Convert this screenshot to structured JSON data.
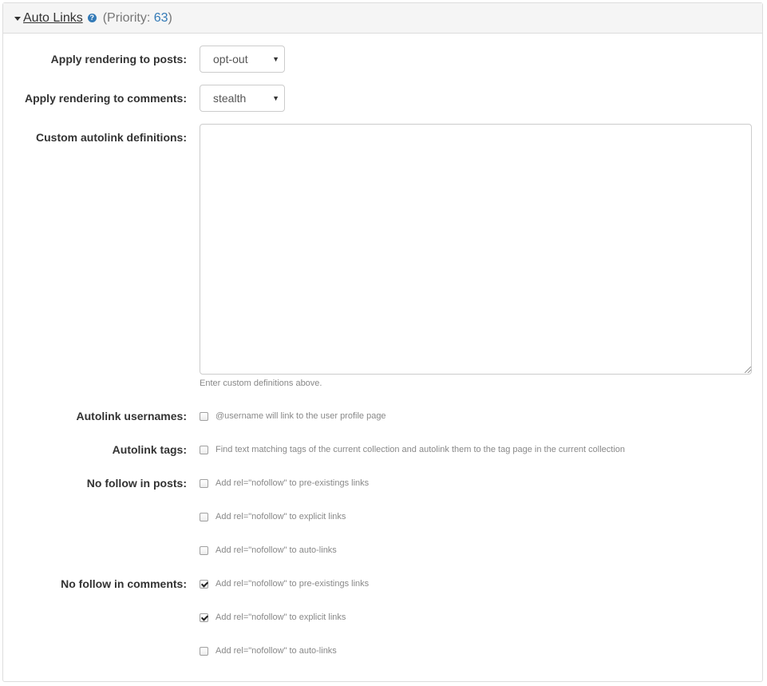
{
  "header": {
    "title": "Auto Links",
    "priority_prefix": "(Priority: ",
    "priority_value": "63",
    "priority_suffix": ")",
    "help_icon": "?"
  },
  "fields": {
    "posts_label": "Apply rendering to posts:",
    "posts_value": "opt-out",
    "comments_label": "Apply rendering to comments:",
    "comments_value": "stealth",
    "custom_label": "Custom autolink definitions:",
    "custom_value": "",
    "custom_help": "Enter custom definitions above.",
    "usernames_label": "Autolink usernames:",
    "usernames_text": "@username will link to the user profile page",
    "usernames_checked": false,
    "tags_label": "Autolink tags:",
    "tags_text": "Find text matching tags of the current collection and autolink them to the tag page in the current collection",
    "tags_checked": false,
    "nofollow_posts_label": "No follow in posts:",
    "nofollow_comments_label": "No follow in comments:"
  },
  "nofollow_posts": [
    {
      "text": "Add rel=\"nofollow\" to pre-existings links",
      "checked": false
    },
    {
      "text": "Add rel=\"nofollow\" to explicit links",
      "checked": false
    },
    {
      "text": "Add rel=\"nofollow\" to auto-links",
      "checked": false
    }
  ],
  "nofollow_comments": [
    {
      "text": "Add rel=\"nofollow\" to pre-existings links",
      "checked": true
    },
    {
      "text": "Add rel=\"nofollow\" to explicit links",
      "checked": true
    },
    {
      "text": "Add rel=\"nofollow\" to auto-links",
      "checked": false
    }
  ],
  "colors": {
    "link": "#337ab7",
    "border": "#dddddd",
    "heading_bg": "#f5f5f5",
    "help_text": "#888888"
  },
  "icons": {
    "collapse": "caret-down-icon",
    "help": "question-circle-icon",
    "select": "select-arrow-icon"
  }
}
